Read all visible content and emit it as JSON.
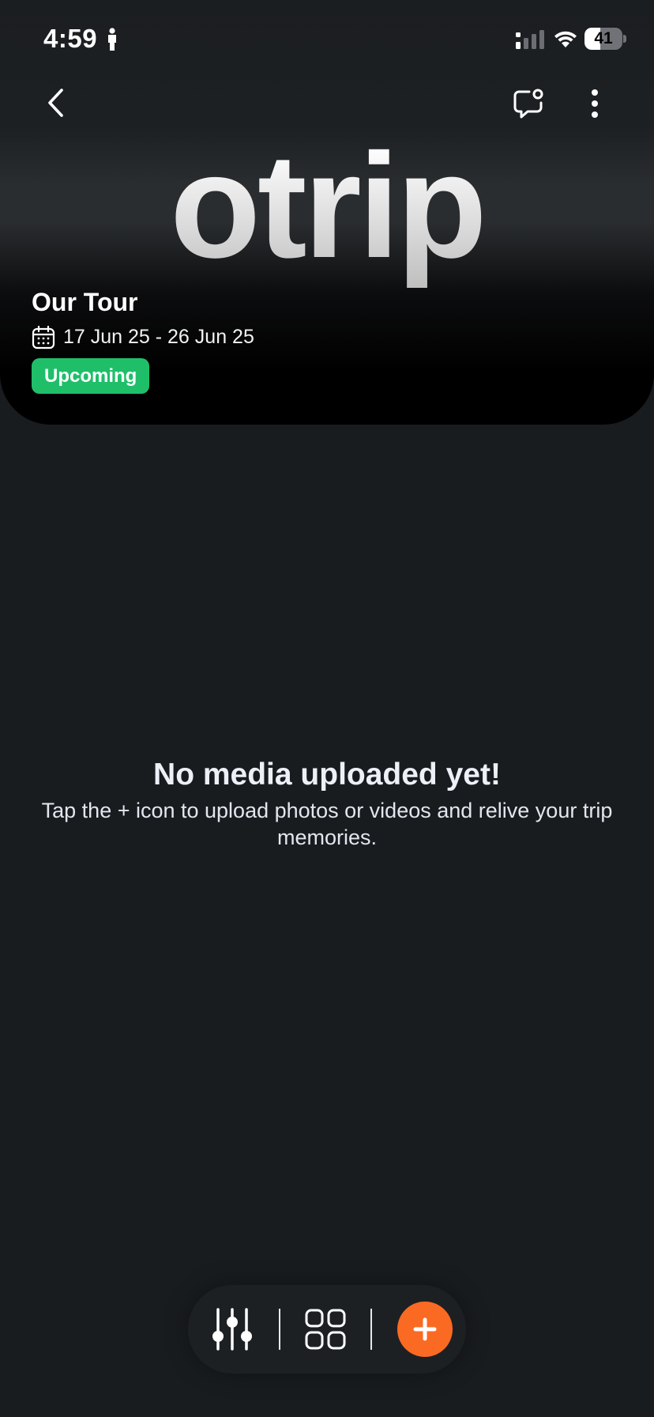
{
  "status_bar": {
    "time": "4:59",
    "battery_level": "41"
  },
  "brand": {
    "logo_text": "otrip"
  },
  "tour": {
    "title": "Our Tour",
    "date_range": "17 Jun 25 - 26 Jun 25",
    "status": "Upcoming"
  },
  "empty_state": {
    "title": "No media uploaded yet!",
    "description": "Tap the + icon to upload photos or videos and relive your trip memories."
  },
  "colors": {
    "background": "#191c1f",
    "badge": "#1fbf6a",
    "accent": "#fb6a22"
  },
  "icons": {
    "back": "chevron-left-icon",
    "chat": "chat-notification-icon",
    "more": "more-vertical-icon",
    "calendar": "calendar-icon",
    "filter": "sliders-icon",
    "grid": "grid-icon",
    "add": "plus-icon"
  }
}
